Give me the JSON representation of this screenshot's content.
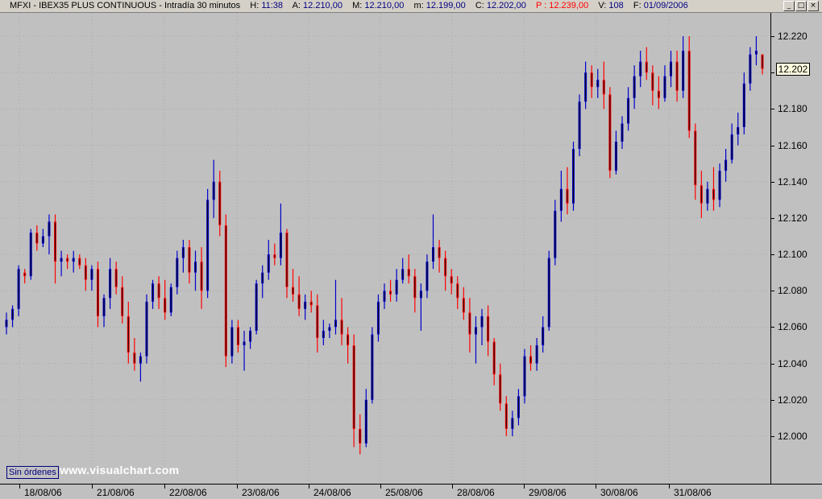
{
  "header": {
    "symbol": "MFXI",
    "name": "IBEX35 PLUS CONTINUOUS",
    "period": "Intradía 30 minutos",
    "hora_label": "H:",
    "hora": "11:38",
    "apertura_label": "A:",
    "apertura": "12.210,00",
    "maximo_label": "M:",
    "maximo": "12.210,00",
    "minimo_label": "m:",
    "minimo": "12.199,00",
    "cierre_label": "C:",
    "cierre": "12.202,00",
    "precio_label": "P :",
    "precio": "12.239,00",
    "volumen_label": "V:",
    "volumen": "108",
    "fecha_label": "F:",
    "fecha": "01/09/2006"
  },
  "window_buttons": {
    "minimize": "_",
    "restore": "□",
    "close": "×"
  },
  "last_price_tag": "12.202",
  "orders_label": "Sin órdenes",
  "watermark": "www.visualchart.com",
  "colors": {
    "background": "#c0c0c0",
    "up_bar": "#0000cc",
    "down_bar": "#ff0000",
    "body_dark": "#000000",
    "price_red": "#ff0000",
    "label_blue": "#000080"
  },
  "chart_data": {
    "type": "ohlc",
    "title": "",
    "xlabel": "",
    "ylabel": "",
    "ylim": [
      11990,
      12225
    ],
    "yticks": [
      "12.220",
      "12.200",
      "12.180",
      "12.160",
      "12.140",
      "12.120",
      "12.100",
      "12.080",
      "12.060",
      "12.040",
      "12.020",
      "12.000"
    ],
    "ytick_values": [
      12220,
      12200,
      12180,
      12160,
      12140,
      12120,
      12100,
      12080,
      12060,
      12040,
      12020,
      12000
    ],
    "day_labels": [
      "18/08/06",
      "21/08/06",
      "22/08/06",
      "23/08/06",
      "24/08/06",
      "25/08/06",
      "28/08/06",
      "29/08/06",
      "30/08/06",
      "31/08/06"
    ],
    "grid": true,
    "days": [
      {
        "label": "18/08/06",
        "open": 12058,
        "high": 12125,
        "low": 12028,
        "close": 12053
      },
      {
        "label": "21/08/06",
        "open": 12053,
        "high": 12108,
        "low": 12030,
        "close": 12078
      },
      {
        "label": "22/08/06",
        "open": 12080,
        "high": 12152,
        "low": 12028,
        "close": 12055
      },
      {
        "label": "23/08/06",
        "open": 12055,
        "high": 12128,
        "low": 12035,
        "close": 12062
      },
      {
        "label": "24/08/06",
        "open": 12062,
        "high": 12098,
        "low": 11990,
        "close": 12085
      },
      {
        "label": "25/08/06",
        "open": 12085,
        "high": 12122,
        "low": 12038,
        "close": 12070
      },
      {
        "label": "28/08/06",
        "open": 12070,
        "high": 12085,
        "low": 12000,
        "close": 12048
      },
      {
        "label": "29/08/06",
        "open": 12050,
        "high": 12205,
        "low": 12045,
        "close": 12195
      },
      {
        "label": "30/08/06",
        "open": 12195,
        "high": 12220,
        "low": 12142,
        "close": 12195
      },
      {
        "label": "31/08/06",
        "open": 12195,
        "high": 12220,
        "low": 12120,
        "close": 12202
      }
    ],
    "bars": [
      {
        "o": 12060,
        "h": 12068,
        "l": 12056,
        "c": 12064
      },
      {
        "o": 12064,
        "h": 12072,
        "l": 12060,
        "c": 12070
      },
      {
        "o": 12070,
        "h": 12094,
        "l": 12066,
        "c": 12092
      },
      {
        "o": 12090,
        "h": 12092,
        "l": 12084,
        "c": 12088
      },
      {
        "o": 12088,
        "h": 12114,
        "l": 12086,
        "c": 12112
      },
      {
        "o": 12112,
        "h": 12116,
        "l": 12102,
        "c": 12106
      },
      {
        "o": 12106,
        "h": 12114,
        "l": 12104,
        "c": 12110
      },
      {
        "o": 12110,
        "h": 12122,
        "l": 12100,
        "c": 12118
      },
      {
        "o": 12118,
        "h": 12122,
        "l": 12084,
        "c": 12096
      },
      {
        "o": 12096,
        "h": 12102,
        "l": 12088,
        "c": 12098
      },
      {
        "o": 12098,
        "h": 12100,
        "l": 12092,
        "c": 12096
      },
      {
        "o": 12096,
        "h": 12102,
        "l": 12090,
        "c": 12098
      },
      {
        "o": 12098,
        "h": 12100,
        "l": 12092,
        "c": 12094
      },
      {
        "o": 12094,
        "h": 12098,
        "l": 12080,
        "c": 12086
      },
      {
        "o": 12086,
        "h": 12094,
        "l": 12080,
        "c": 12092
      },
      {
        "o": 12092,
        "h": 12096,
        "l": 12060,
        "c": 12066
      },
      {
        "o": 12066,
        "h": 12078,
        "l": 12060,
        "c": 12076
      },
      {
        "o": 12076,
        "h": 12098,
        "l": 12070,
        "c": 12092
      },
      {
        "o": 12092,
        "h": 12096,
        "l": 12078,
        "c": 12082
      },
      {
        "o": 12082,
        "h": 12088,
        "l": 12062,
        "c": 12066
      },
      {
        "o": 12066,
        "h": 12074,
        "l": 12040,
        "c": 12046
      },
      {
        "o": 12046,
        "h": 12054,
        "l": 12036,
        "c": 12040
      },
      {
        "o": 12040,
        "h": 12046,
        "l": 12030,
        "c": 12044
      },
      {
        "o": 12044,
        "h": 12078,
        "l": 12040,
        "c": 12074
      },
      {
        "o": 12074,
        "h": 12086,
        "l": 12070,
        "c": 12084
      },
      {
        "o": 12084,
        "h": 12088,
        "l": 12070,
        "c": 12076
      },
      {
        "o": 12076,
        "h": 12086,
        "l": 12064,
        "c": 12068
      },
      {
        "o": 12068,
        "h": 12084,
        "l": 12066,
        "c": 12082
      },
      {
        "o": 12082,
        "h": 12102,
        "l": 12078,
        "c": 12098
      },
      {
        "o": 12098,
        "h": 12108,
        "l": 12090,
        "c": 12104
      },
      {
        "o": 12104,
        "h": 12108,
        "l": 12084,
        "c": 12090
      },
      {
        "o": 12090,
        "h": 12102,
        "l": 12080,
        "c": 12096
      },
      {
        "o": 12096,
        "h": 12104,
        "l": 12070,
        "c": 12080
      },
      {
        "o": 12080,
        "h": 12136,
        "l": 12076,
        "c": 12130
      },
      {
        "o": 12130,
        "h": 12152,
        "l": 12120,
        "c": 12140
      },
      {
        "o": 12140,
        "h": 12146,
        "l": 12110,
        "c": 12116
      },
      {
        "o": 12116,
        "h": 12122,
        "l": 12038,
        "c": 12044
      },
      {
        "o": 12044,
        "h": 12064,
        "l": 12040,
        "c": 12060
      },
      {
        "o": 12060,
        "h": 12064,
        "l": 12046,
        "c": 12050
      },
      {
        "o": 12050,
        "h": 12058,
        "l": 12036,
        "c": 12052
      },
      {
        "o": 12052,
        "h": 12060,
        "l": 12048,
        "c": 12058
      },
      {
        "o": 12058,
        "h": 12086,
        "l": 12056,
        "c": 12084
      },
      {
        "o": 12084,
        "h": 12094,
        "l": 12076,
        "c": 12090
      },
      {
        "o": 12090,
        "h": 12108,
        "l": 12086,
        "c": 12100
      },
      {
        "o": 12100,
        "h": 12106,
        "l": 12094,
        "c": 12098
      },
      {
        "o": 12098,
        "h": 12128,
        "l": 12094,
        "c": 12112
      },
      {
        "o": 12112,
        "h": 12114,
        "l": 12076,
        "c": 12082
      },
      {
        "o": 12082,
        "h": 12092,
        "l": 12074,
        "c": 12078
      },
      {
        "o": 12078,
        "h": 12088,
        "l": 12066,
        "c": 12070
      },
      {
        "o": 12070,
        "h": 12078,
        "l": 12064,
        "c": 12074
      },
      {
        "o": 12074,
        "h": 12080,
        "l": 12068,
        "c": 12072
      },
      {
        "o": 12072,
        "h": 12078,
        "l": 12046,
        "c": 12054
      },
      {
        "o": 12054,
        "h": 12064,
        "l": 12050,
        "c": 12058
      },
      {
        "o": 12058,
        "h": 12062,
        "l": 12054,
        "c": 12060
      },
      {
        "o": 12060,
        "h": 12086,
        "l": 12056,
        "c": 12064
      },
      {
        "o": 12064,
        "h": 12076,
        "l": 12050,
        "c": 12056
      },
      {
        "o": 12056,
        "h": 12060,
        "l": 12040,
        "c": 12050
      },
      {
        "o": 12050,
        "h": 12056,
        "l": 11994,
        "c": 12004
      },
      {
        "o": 12004,
        "h": 12012,
        "l": 11990,
        "c": 11996
      },
      {
        "o": 11996,
        "h": 12026,
        "l": 11994,
        "c": 12020
      },
      {
        "o": 12020,
        "h": 12060,
        "l": 12018,
        "c": 12056
      },
      {
        "o": 12056,
        "h": 12078,
        "l": 12052,
        "c": 12074
      },
      {
        "o": 12074,
        "h": 12084,
        "l": 12070,
        "c": 12080
      },
      {
        "o": 12080,
        "h": 12086,
        "l": 12074,
        "c": 12078
      },
      {
        "o": 12078,
        "h": 12092,
        "l": 12074,
        "c": 12086
      },
      {
        "o": 12086,
        "h": 12098,
        "l": 12084,
        "c": 12092
      },
      {
        "o": 12092,
        "h": 12100,
        "l": 12084,
        "c": 12088
      },
      {
        "o": 12088,
        "h": 12092,
        "l": 12068,
        "c": 12076
      },
      {
        "o": 12076,
        "h": 12084,
        "l": 12058,
        "c": 12080
      },
      {
        "o": 12080,
        "h": 12100,
        "l": 12076,
        "c": 12096
      },
      {
        "o": 12096,
        "h": 12122,
        "l": 12092,
        "c": 12104
      },
      {
        "o": 12104,
        "h": 12108,
        "l": 12090,
        "c": 12098
      },
      {
        "o": 12098,
        "h": 12102,
        "l": 12080,
        "c": 12088
      },
      {
        "o": 12088,
        "h": 12092,
        "l": 12078,
        "c": 12084
      },
      {
        "o": 12084,
        "h": 12088,
        "l": 12070,
        "c": 12076
      },
      {
        "o": 12076,
        "h": 12082,
        "l": 12064,
        "c": 12068
      },
      {
        "o": 12068,
        "h": 12076,
        "l": 12046,
        "c": 12056
      },
      {
        "o": 12056,
        "h": 12066,
        "l": 12040,
        "c": 12060
      },
      {
        "o": 12060,
        "h": 12070,
        "l": 12050,
        "c": 12066
      },
      {
        "o": 12066,
        "h": 12072,
        "l": 12044,
        "c": 12052
      },
      {
        "o": 12052,
        "h": 12054,
        "l": 12028,
        "c": 12034
      },
      {
        "o": 12034,
        "h": 12040,
        "l": 12014,
        "c": 12018
      },
      {
        "o": 12018,
        "h": 12022,
        "l": 12000,
        "c": 12004
      },
      {
        "o": 12004,
        "h": 12014,
        "l": 12000,
        "c": 12010
      },
      {
        "o": 12010,
        "h": 12026,
        "l": 12006,
        "c": 12022
      },
      {
        "o": 12022,
        "h": 12048,
        "l": 12018,
        "c": 12044
      },
      {
        "o": 12044,
        "h": 12050,
        "l": 12036,
        "c": 12040
      },
      {
        "o": 12040,
        "h": 12054,
        "l": 12036,
        "c": 12050
      },
      {
        "o": 12050,
        "h": 12066,
        "l": 12046,
        "c": 12060
      },
      {
        "o": 12060,
        "h": 12102,
        "l": 12058,
        "c": 12098
      },
      {
        "o": 12098,
        "h": 12130,
        "l": 12094,
        "c": 12124
      },
      {
        "o": 12124,
        "h": 12146,
        "l": 12118,
        "c": 12136
      },
      {
        "o": 12136,
        "h": 12148,
        "l": 12122,
        "c": 12128
      },
      {
        "o": 12128,
        "h": 12162,
        "l": 12124,
        "c": 12158
      },
      {
        "o": 12158,
        "h": 12188,
        "l": 12154,
        "c": 12184
      },
      {
        "o": 12184,
        "h": 12206,
        "l": 12180,
        "c": 12200
      },
      {
        "o": 12200,
        "h": 12204,
        "l": 12186,
        "c": 12192
      },
      {
        "o": 12192,
        "h": 12202,
        "l": 12186,
        "c": 12196
      },
      {
        "o": 12196,
        "h": 12206,
        "l": 12180,
        "c": 12188
      },
      {
        "o": 12188,
        "h": 12192,
        "l": 12142,
        "c": 12146
      },
      {
        "o": 12146,
        "h": 12168,
        "l": 12144,
        "c": 12162
      },
      {
        "o": 12162,
        "h": 12176,
        "l": 12158,
        "c": 12172
      },
      {
        "o": 12172,
        "h": 12192,
        "l": 12168,
        "c": 12186
      },
      {
        "o": 12186,
        "h": 12204,
        "l": 12180,
        "c": 12198
      },
      {
        "o": 12198,
        "h": 12212,
        "l": 12192,
        "c": 12206
      },
      {
        "o": 12206,
        "h": 12214,
        "l": 12196,
        "c": 12200
      },
      {
        "o": 12200,
        "h": 12204,
        "l": 12182,
        "c": 12190
      },
      {
        "o": 12190,
        "h": 12198,
        "l": 12180,
        "c": 12186
      },
      {
        "o": 12186,
        "h": 12204,
        "l": 12184,
        "c": 12198
      },
      {
        "o": 12198,
        "h": 12212,
        "l": 12192,
        "c": 12206
      },
      {
        "o": 12206,
        "h": 12212,
        "l": 12184,
        "c": 12190
      },
      {
        "o": 12190,
        "h": 12220,
        "l": 12186,
        "c": 12212
      },
      {
        "o": 12212,
        "h": 12220,
        "l": 12164,
        "c": 12168
      },
      {
        "o": 12168,
        "h": 12172,
        "l": 12130,
        "c": 12138
      },
      {
        "o": 12138,
        "h": 12146,
        "l": 12120,
        "c": 12128
      },
      {
        "o": 12128,
        "h": 12140,
        "l": 12124,
        "c": 12136
      },
      {
        "o": 12136,
        "h": 12148,
        "l": 12124,
        "c": 12130
      },
      {
        "o": 12130,
        "h": 12150,
        "l": 12126,
        "c": 12146
      },
      {
        "o": 12146,
        "h": 12158,
        "l": 12140,
        "c": 12152
      },
      {
        "o": 12152,
        "h": 12172,
        "l": 12150,
        "c": 12166
      },
      {
        "o": 12166,
        "h": 12178,
        "l": 12160,
        "c": 12170
      },
      {
        "o": 12170,
        "h": 12200,
        "l": 12166,
        "c": 12194
      },
      {
        "o": 12194,
        "h": 12214,
        "l": 12190,
        "c": 12210
      },
      {
        "o": 12210,
        "h": 12220,
        "l": 12204,
        "c": 12212
      },
      {
        "o": 12210,
        "h": 12210,
        "l": 12199,
        "c": 12202
      }
    ]
  }
}
